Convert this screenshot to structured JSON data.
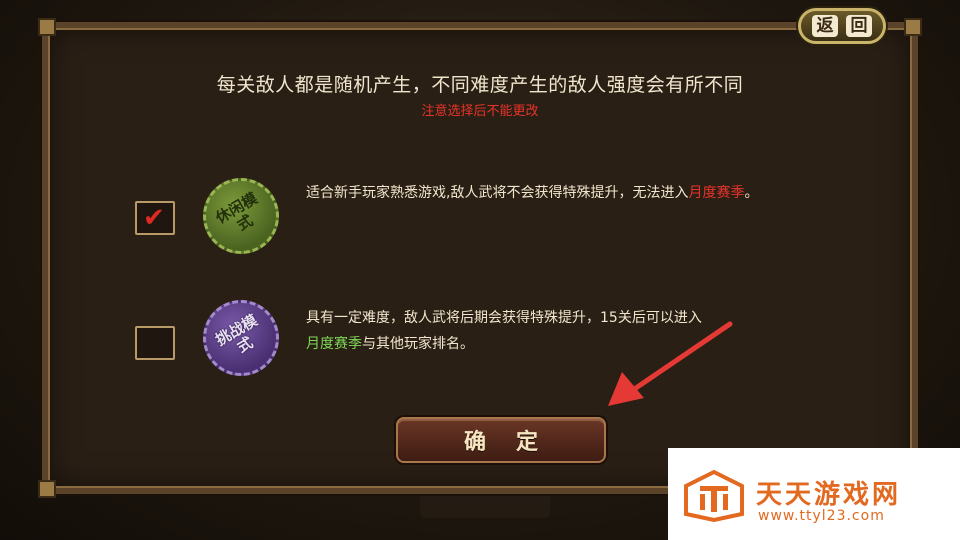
{
  "header": {
    "back_chars": [
      "返",
      "回"
    ]
  },
  "title": "每关敌人都是随机产生，不同难度产生的敌人强度会有所不同",
  "warning": "注意选择后不能更改",
  "options": [
    {
      "checked": true,
      "badge_text": "休闲模式",
      "badge_color": "#5f7a2c",
      "desc_main": "适合新手玩家熟悉游戏,敌人武将不会获得特殊提升，无法进入",
      "desc_highlight": "月度赛季",
      "desc_tail": "。",
      "highlight_color": "#e8332a"
    },
    {
      "checked": false,
      "badge_text": "挑战模式",
      "badge_color": "#5e3f8c",
      "desc_main": "具有一定难度，敌人武将后期会获得特殊提升，15关后可以进入",
      "desc_highlight": "月度赛季",
      "desc_tail": "与其他玩家排名。",
      "highlight_color": "#7ed957"
    }
  ],
  "confirm_label": "确定",
  "annotation_arrow_color": "#e53935",
  "watermark": {
    "name": "天天游戏网",
    "url": "www.ttyl23.com",
    "color": "#e2691f"
  }
}
